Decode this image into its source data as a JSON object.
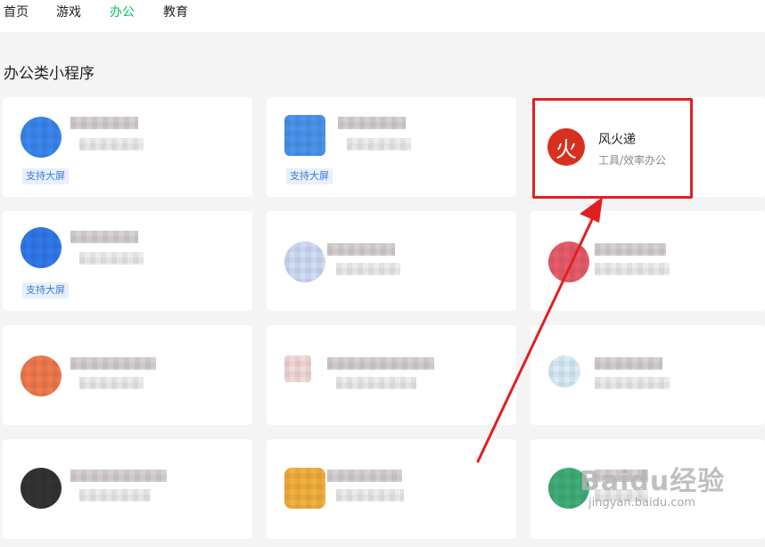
{
  "nav": {
    "items": [
      {
        "label": "首页"
      },
      {
        "label": "游戏"
      },
      {
        "label": "办公"
      },
      {
        "label": "教育"
      }
    ],
    "active_index": 2
  },
  "section": {
    "title": "办公类小程序"
  },
  "badge_text": "支持大屏",
  "highlighted_app": {
    "icon_char": "火",
    "name": "风火递",
    "category": "工具/效率办公"
  },
  "colors": {
    "accent_green": "#07c160",
    "highlight_red": "#e02020",
    "badge_blue": "#3c7bd4",
    "fx_icon_red": "#d8301f"
  },
  "watermark": {
    "main": "Baidu经验",
    "sub": "jingyan.baidu.com"
  }
}
